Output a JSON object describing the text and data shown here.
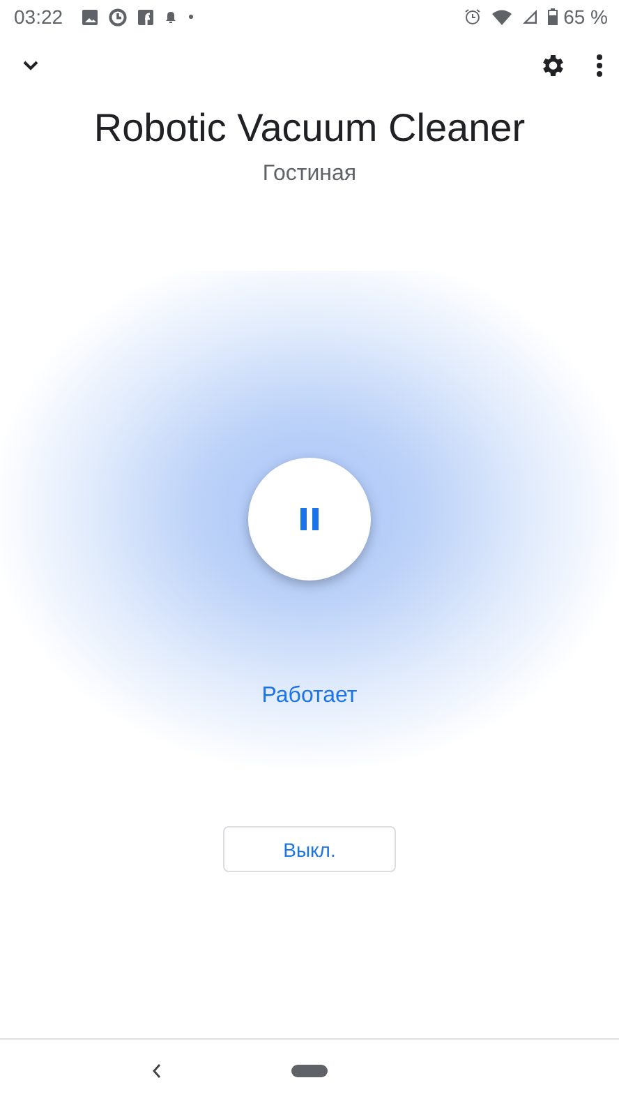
{
  "status_bar": {
    "time": "03:22",
    "battery": "65 %"
  },
  "header": {
    "title": "Robotic Vacuum Cleaner",
    "room": "Гостиная"
  },
  "control": {
    "running": true,
    "status": "Работает"
  },
  "off_button": {
    "label": "Выкл."
  }
}
